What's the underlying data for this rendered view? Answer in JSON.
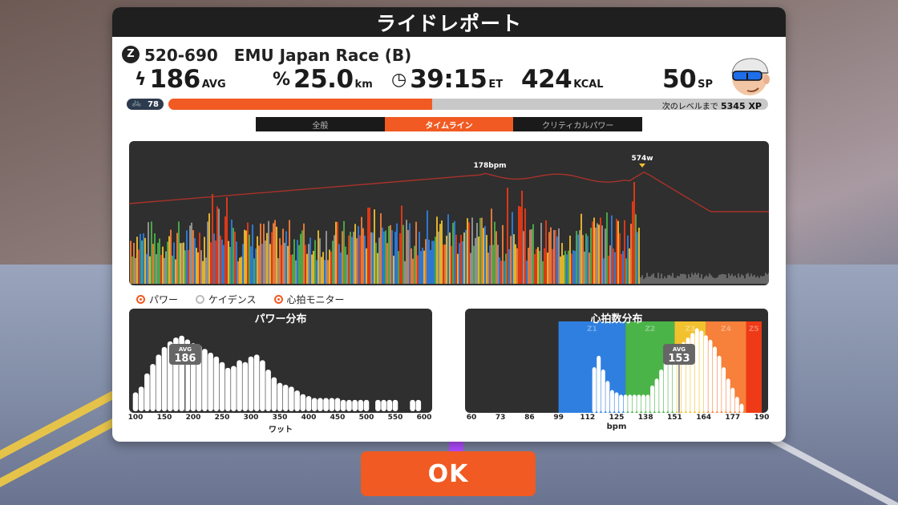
{
  "header": {
    "title": "ライドレポート"
  },
  "race": {
    "title": "520-690　EMU Japan Race (B)"
  },
  "stats": {
    "power": {
      "value": "186",
      "unit": "AVG"
    },
    "distance": {
      "value": "25.0",
      "unit": "km"
    },
    "time": {
      "value": "39:15",
      "unit": "ET"
    },
    "calories": {
      "value": "424",
      "unit": "KCAL"
    },
    "sp": {
      "value": "50",
      "unit": "SP"
    }
  },
  "level": {
    "value": "78",
    "progress_fraction": 0.44,
    "next_level_label": "次のレベルまで",
    "xp_remaining": "5345 XP"
  },
  "tabs": [
    {
      "label": "全般",
      "active": false
    },
    {
      "label": "タイムライン",
      "active": true
    },
    {
      "label": "クリティカルパワー",
      "active": false
    }
  ],
  "timeline": {
    "hr_peak_label": "178bpm",
    "power_peak_label": "574w"
  },
  "legend": [
    {
      "label": "パワー",
      "on": true
    },
    {
      "label": "ケイデンス",
      "on": false
    },
    {
      "label": "心拍モニター",
      "on": true
    }
  ],
  "colors": {
    "accent": "#f15a22",
    "panel_dark": "#2f2f2f",
    "zone_blue": "#2f7fe0",
    "zone_green": "#4bb449",
    "zone_yellow": "#f2c12e",
    "zone_orange": "#f7803a",
    "zone_red": "#ee3a16"
  },
  "chart_data": [
    {
      "type": "bar",
      "title": "パワー分布",
      "xlabel": "ワット",
      "x_ticks": [
        "100",
        "150",
        "200",
        "250",
        "300",
        "350",
        "400",
        "450",
        "500",
        "550",
        "600"
      ],
      "avg_label": "AVG",
      "avg_value": "186",
      "x": [
        100,
        110,
        120,
        130,
        140,
        150,
        160,
        170,
        180,
        190,
        200,
        210,
        220,
        230,
        240,
        250,
        260,
        270,
        280,
        290,
        300,
        310,
        320,
        330,
        340,
        350,
        360,
        370,
        380,
        390,
        400,
        410,
        420,
        430,
        440,
        450,
        460,
        470,
        480,
        490,
        500,
        510,
        520,
        530,
        540,
        550,
        560,
        570,
        580,
        590,
        600
      ],
      "values": [
        20,
        26,
        40,
        50,
        60,
        68,
        74,
        78,
        80,
        76,
        72,
        70,
        66,
        62,
        58,
        52,
        46,
        48,
        54,
        52,
        58,
        60,
        54,
        44,
        36,
        30,
        28,
        26,
        22,
        18,
        16,
        14,
        14,
        14,
        14,
        14,
        12,
        12,
        12,
        12,
        12,
        0,
        12,
        12,
        12,
        12,
        0,
        0,
        12,
        12,
        0
      ],
      "ylim": [
        0,
        90
      ]
    },
    {
      "type": "bar",
      "title": "心拍数分布",
      "xlabel": "bpm",
      "x_ticks": [
        "60",
        "73",
        "86",
        "99",
        "112",
        "125",
        "138",
        "151",
        "164",
        "177",
        "190"
      ],
      "zones": [
        "Z1",
        "Z2",
        "Z3",
        "Z4",
        "Z5"
      ],
      "avg_label": "AVG",
      "avg_value": "153",
      "x": [
        115,
        117,
        119,
        121,
        123,
        125,
        127,
        129,
        131,
        133,
        135,
        137,
        139,
        141,
        143,
        145,
        147,
        149,
        151,
        153,
        155,
        157,
        159,
        161,
        163,
        165,
        167,
        169,
        171,
        173,
        175,
        177,
        179,
        181,
        183
      ],
      "values": [
        40,
        50,
        38,
        28,
        20,
        18,
        16,
        16,
        16,
        16,
        16,
        16,
        16,
        24,
        30,
        38,
        46,
        48,
        52,
        58,
        62,
        66,
        70,
        74,
        72,
        68,
        64,
        58,
        50,
        40,
        30,
        22,
        14,
        8,
        0
      ],
      "ylim": [
        0,
        80
      ]
    }
  ]
}
